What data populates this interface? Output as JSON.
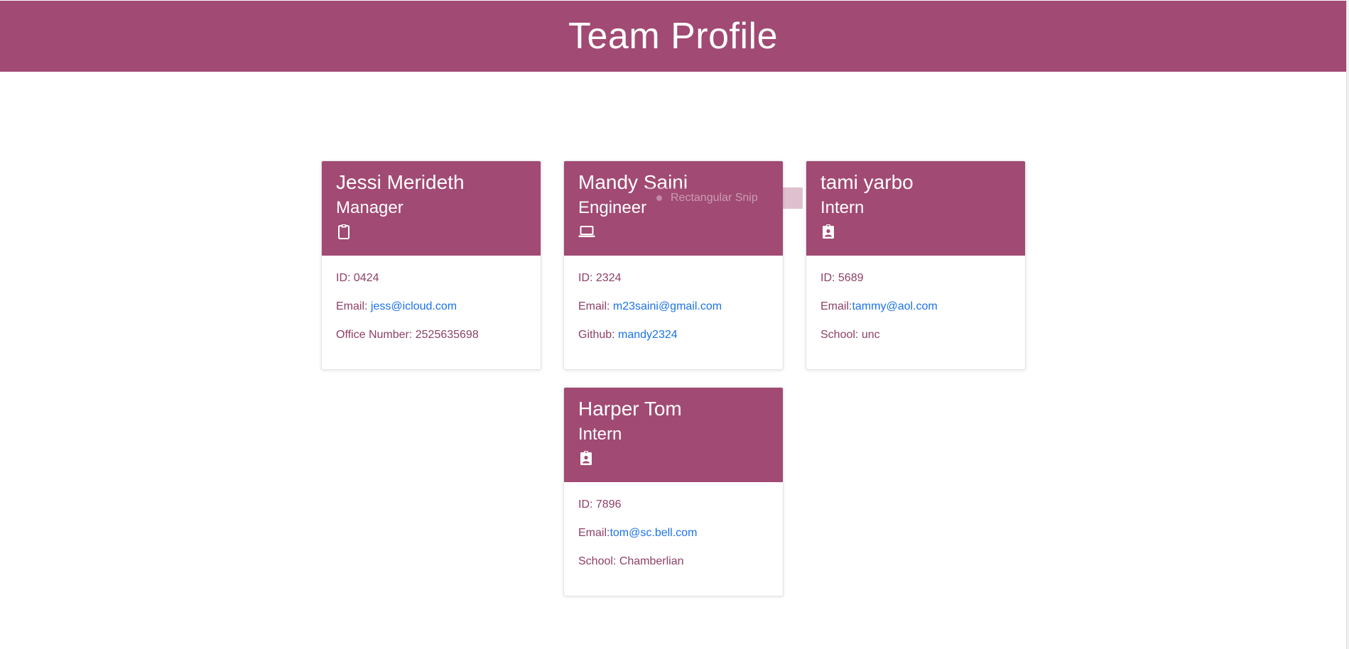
{
  "header": {
    "title": "Team Profile"
  },
  "colors": {
    "brand": "#a14a73",
    "detail_text": "#8e3f66",
    "link": "#1a73e8"
  },
  "overlay": {
    "label": "Rectangular Snip"
  },
  "cards": [
    {
      "name": "Jessi Merideth",
      "role": "Manager",
      "icon": "clipboard-icon",
      "id_label": "ID: 0424",
      "email_prefix": "Email: ",
      "email": "jess@icloud.com",
      "extra_label": "Office Number: 2525635698"
    },
    {
      "name": "Mandy Saini",
      "role": "Engineer",
      "icon": "laptop-icon",
      "id_label": "ID: 2324",
      "email_prefix": "Email: ",
      "email": "m23saini@gmail.com",
      "extra_prefix": "Github: ",
      "extra_link": "mandy2324"
    },
    {
      "name": "tami yarbo",
      "role": "Intern",
      "icon": "id-badge-icon",
      "id_label": "ID: 5689",
      "email_prefix": "Email:",
      "email": "tammy@aol.com",
      "extra_label": "School: unc"
    },
    {
      "name": "Harper Tom",
      "role": "Intern",
      "icon": "id-badge-icon",
      "id_label": "ID: 7896",
      "email_prefix": "Email:",
      "email": "tom@sc.bell.com",
      "extra_label": "School: Chamberlian"
    }
  ]
}
